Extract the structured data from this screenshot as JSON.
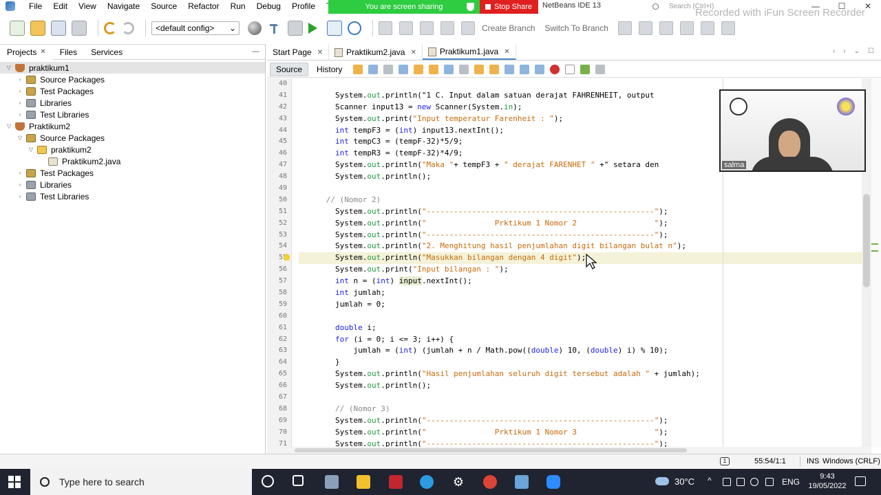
{
  "menubar": {
    "items": [
      "File",
      "Edit",
      "View",
      "Navigate",
      "Source",
      "Refactor",
      "Run",
      "Debug",
      "Profile",
      "Team"
    ],
    "sharing_label": "You are screen sharing",
    "stop_share_label": "Stop Share",
    "ide_title": "NetBeans IDE 13",
    "search_placeholder": "Search (Ctrl+I)",
    "watermark": "Recorded with iFun Screen Recorder"
  },
  "toolbar": {
    "config": "<default config>",
    "create_branch": "Create Branch",
    "switch_branch": "Switch To Branch"
  },
  "left_panel": {
    "tabs": [
      "Projects",
      "Files",
      "Services"
    ],
    "tree": [
      {
        "label": "praktikum1",
        "expanded": true,
        "icon": "project-cup-icon"
      },
      {
        "label": "Source Packages",
        "expanded": false,
        "icon": "source-packages-icon"
      },
      {
        "label": "Test Packages",
        "expanded": false,
        "icon": "test-packages-icon"
      },
      {
        "label": "Libraries",
        "expanded": false,
        "icon": "libraries-icon"
      },
      {
        "label": "Test Libraries",
        "expanded": false,
        "icon": "test-libraries-icon"
      },
      {
        "label": "Praktikum2",
        "expanded": true,
        "icon": "project-cup-icon"
      },
      {
        "label": "Source Packages",
        "expanded": true,
        "icon": "source-packages-icon"
      },
      {
        "label": "praktikum2",
        "expanded": true,
        "icon": "package-icon"
      },
      {
        "label": "Praktikum2.java",
        "icon": "java-file-icon"
      },
      {
        "label": "Test Packages",
        "expanded": false,
        "icon": "test-packages-icon"
      },
      {
        "label": "Libraries",
        "expanded": false,
        "icon": "libraries-icon"
      },
      {
        "label": "Test Libraries",
        "expanded": false,
        "icon": "test-libraries-icon"
      }
    ]
  },
  "editor": {
    "tabs": [
      "Start Page",
      "Praktikum2.java",
      "Praktikum1.java"
    ],
    "active_tab": "Praktikum1.java",
    "modes": [
      "Source",
      "History"
    ],
    "line_numbers": [
      "40",
      "41",
      "42",
      "43",
      "44",
      "45",
      "46",
      "47",
      "48",
      "49",
      "50",
      "51",
      "52",
      "53",
      "54",
      "55",
      "56",
      "57",
      "58",
      "59",
      "60",
      "61",
      "62",
      "63",
      "64",
      "65",
      "66",
      "67",
      "68",
      "69",
      "70",
      "71"
    ],
    "code_lines": [
      "",
      "        System.out.println(\"1 C. Input dalam satuan derajat FAHRENHEIT, output",
      "        Scanner input13 = new Scanner(System.in);",
      "        System.out.print(\"Input temperatur Farenheit : \");",
      "        int tempF3 = (int) input13.nextInt();",
      "        int tempC3 = (tempF-32)*5/9;",
      "        int tempR3 = (tempF-32)*4/9;",
      "        System.out.println(\"Maka \"+ tempF3 + \" derajat FARENHET \" +\" setara den",
      "        System.out.println();",
      "",
      "      // (Nomor 2)",
      "        System.out.println(\"--------------------------------------------------\");",
      "        System.out.println(\"               Prktikum 1 Nomor 2                 \");",
      "        System.out.println(\"--------------------------------------------------\");",
      "        System.out.println(\"2. Menghitung hasil penjumlahan digit bilangan bulat n\");",
      "        System.out.println(\"Masukkan bilangan dengan 4 digit\");",
      "        System.out.print(\"Input bilangan : \");",
      "        int n = (int) input.nextInt();",
      "        int jumlah;",
      "        jumlah = 0;",
      "",
      "        double i;",
      "        for (i = 0; i <= 3; i++) {",
      "            jumlah = (int) (jumlah + n / Math.pow((double) 10, (double) i) % 10);",
      "        }",
      "        System.out.println(\"Hasil penjumlahan seluruh digit tersebut adalah \" + jumlah);",
      "        System.out.println();",
      "",
      "        // (Nomor 3)",
      "        System.out.println(\"--------------------------------------------------\");",
      "        System.out.println(\"               Prktikum 1 Nomor 3                 \");",
      "        System.out.println(\"--------------------------------------------------\");"
    ]
  },
  "webcam": {
    "name": "salma"
  },
  "statusbar": {
    "notifications": "1",
    "position": "55:54/1:1",
    "mode": "INS",
    "line_ending": "Windows (CRLF)"
  },
  "taskbar": {
    "search_placeholder": "Type here to search",
    "temperature": "30°C",
    "language": "ENG",
    "time": "9:43",
    "date": "19/05/2022"
  }
}
